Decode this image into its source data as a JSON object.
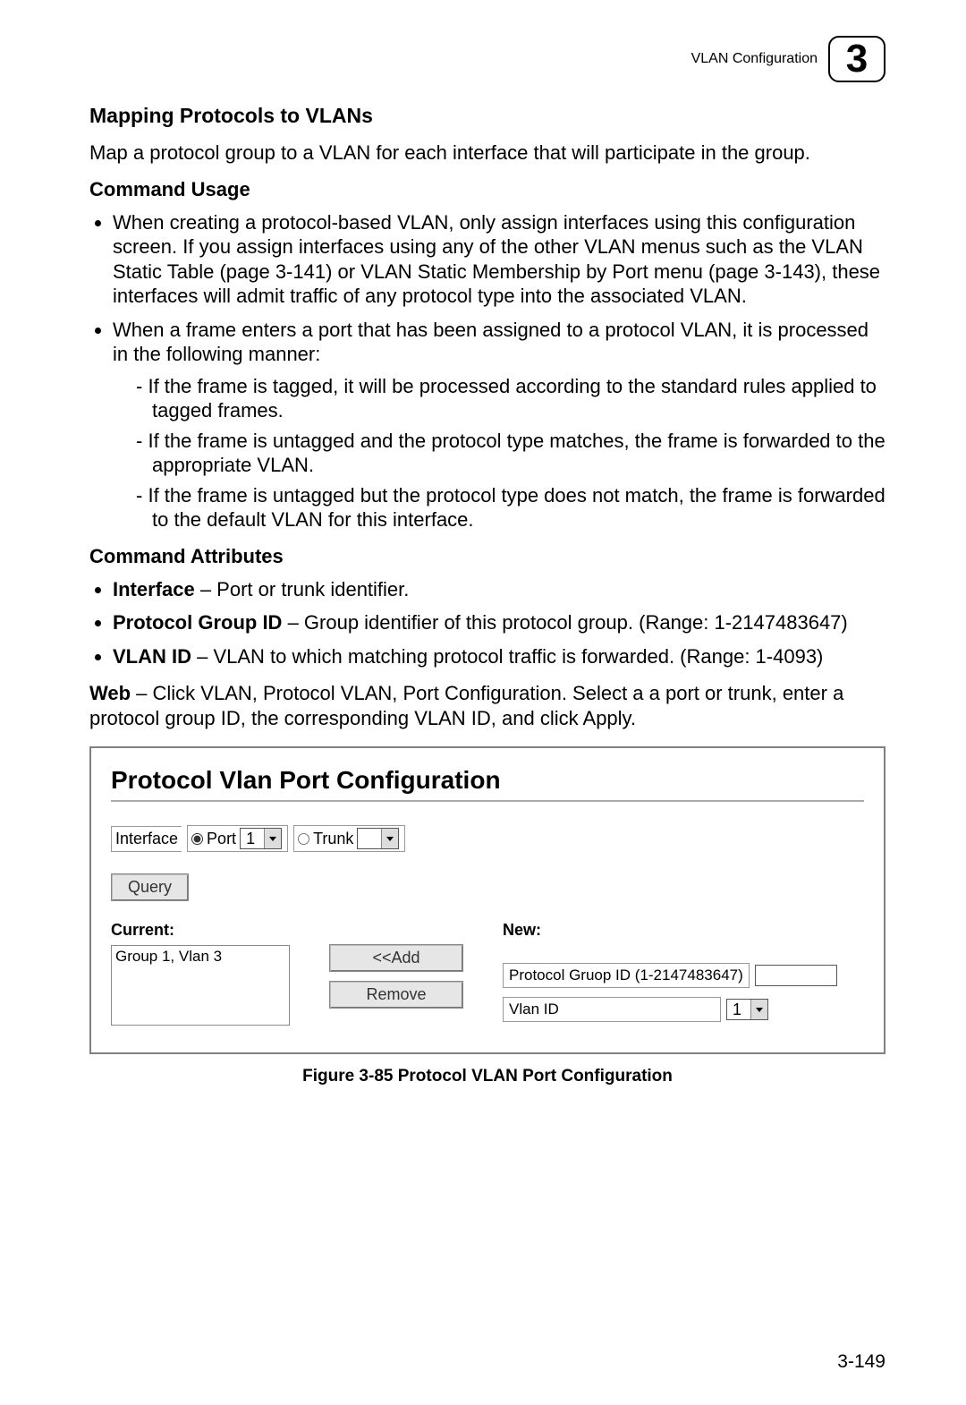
{
  "header": {
    "section_title": "VLAN Configuration",
    "chapter_number": "3"
  },
  "doc": {
    "title": "Mapping Protocols to VLANs",
    "intro": "Map a protocol group to a VLAN for each interface that will participate in the group.",
    "usage_heading": "Command Usage",
    "usage_bullet_1": "When creating a protocol-based VLAN, only assign interfaces using this configuration screen. If you assign interfaces using any of the other VLAN menus such as the VLAN Static Table (page 3-141) or VLAN Static Membership by Port menu (page 3-143), these interfaces will admit traffic of any protocol type into the associated VLAN.",
    "usage_bullet_2_lead": "When a frame enters a port that has been assigned to a protocol VLAN, it is processed in the following manner:",
    "usage_dash_1": "If the frame is tagged, it will be processed according to the standard rules applied to tagged frames.",
    "usage_dash_2": "If the frame is untagged and the protocol type matches, the frame is forwarded to the appropriate VLAN.",
    "usage_dash_3": "If the frame is untagged but the protocol type does not match, the frame is forwarded to the default VLAN for this interface.",
    "attrs_heading": "Command Attributes",
    "attr_interface_name": "Interface",
    "attr_interface_desc": " – Port or trunk identifier.",
    "attr_pgid_name": "Protocol Group ID",
    "attr_pgid_desc": " – Group identifier of this protocol group. (Range: 1-2147483647)",
    "attr_vlan_name": "VLAN ID",
    "attr_vlan_desc": " – VLAN to which matching protocol traffic is forwarded. (Range: 1-4093)",
    "web_bold": "Web",
    "web_text": " – Click VLAN, Protocol VLAN, Port Configuration. Select a a port or trunk, enter a protocol group ID, the corresponding VLAN ID, and click Apply."
  },
  "screenshot": {
    "panel_title": "Protocol Vlan Port Configuration",
    "interface_label": "Interface",
    "port_label": "Port",
    "port_value": "1",
    "trunk_label": "Trunk",
    "trunk_value": "",
    "query_button": "Query",
    "current_heading": "Current:",
    "current_item": "Group 1, Vlan 3",
    "new_heading": "New:",
    "add_button": "<<Add",
    "remove_button": "Remove",
    "pgid_label": "Protocol Gruop ID (1-2147483647)",
    "pgid_value": "",
    "vlanid_label": "Vlan ID",
    "vlanid_value": "1"
  },
  "caption": "Figure 3-85   Protocol VLAN Port Configuration",
  "page_number": "3-149"
}
